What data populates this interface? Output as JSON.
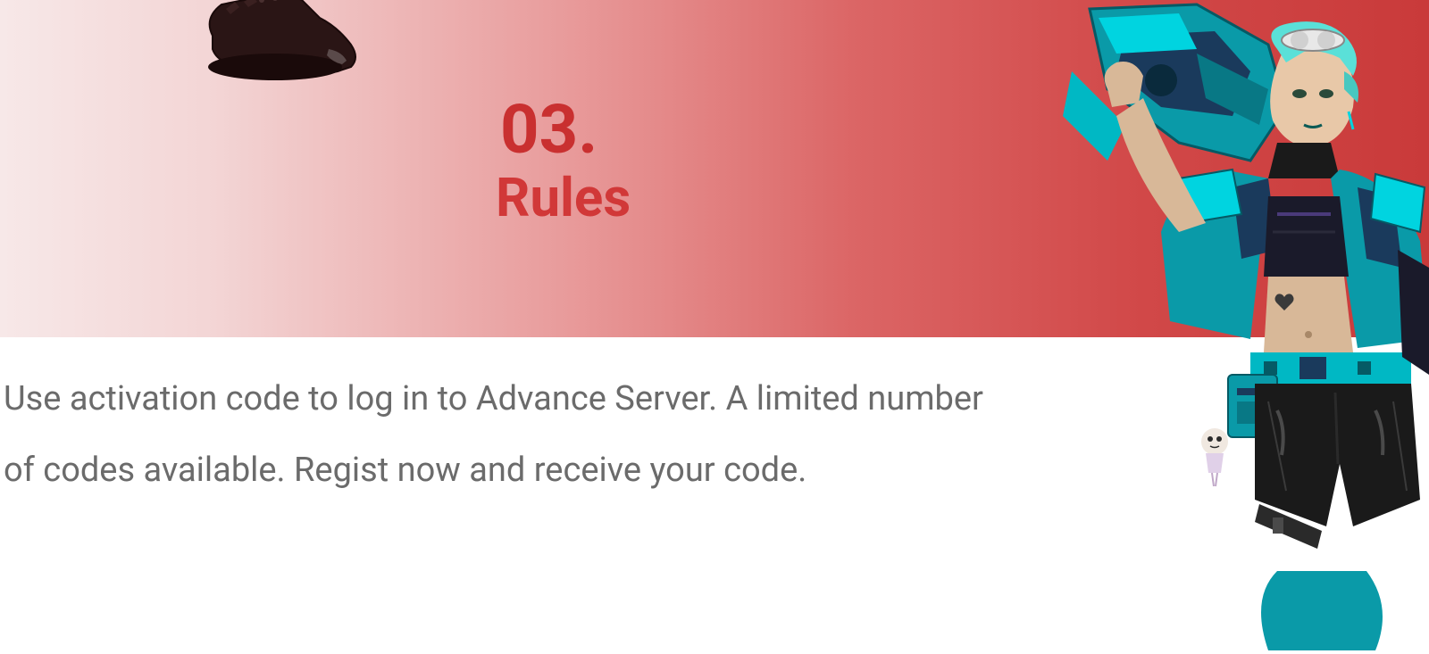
{
  "section": {
    "number": "03.",
    "title": "Rules",
    "body_text": "Use activation code to log in to Advance Server. A limited number of codes available. Regist now and receive your code."
  },
  "graphics": {
    "boot": "boot-item",
    "character": "game-character"
  },
  "colors": {
    "accent": "#c93030",
    "gradient_start": "#f7e8e8",
    "gradient_end": "#c93a3a",
    "text_body": "#6b6b6b",
    "character_primary": "#00b8c4",
    "character_secondary": "#1a3a5c"
  }
}
